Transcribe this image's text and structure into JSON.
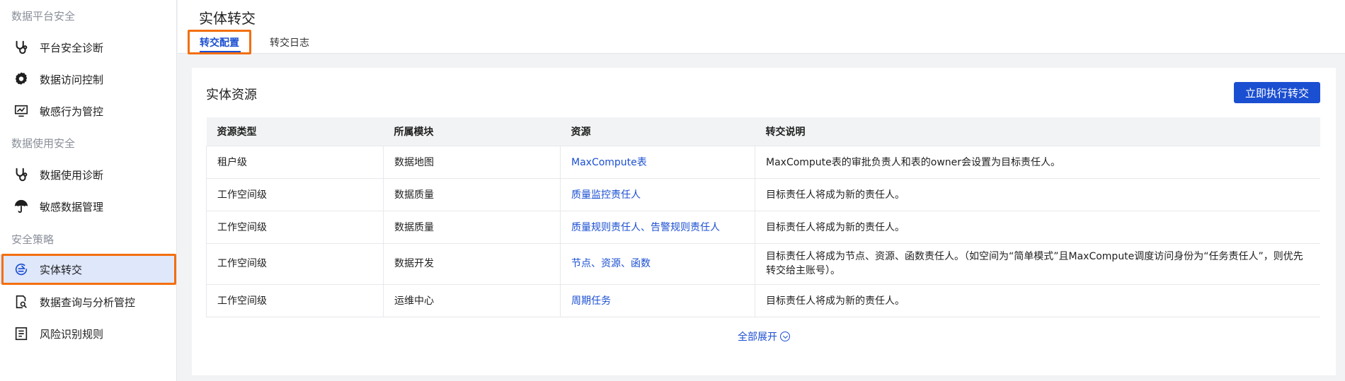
{
  "sidebar": {
    "groups": [
      {
        "title": "数据平台安全",
        "items": [
          {
            "label": "平台安全诊断",
            "icon": "stethoscope-icon"
          },
          {
            "label": "数据访问控制",
            "icon": "gear-icon"
          },
          {
            "label": "敏感行为管控",
            "icon": "monitor-chart-icon"
          }
        ]
      },
      {
        "title": "数据使用安全",
        "items": [
          {
            "label": "数据使用诊断",
            "icon": "stethoscope-icon"
          },
          {
            "label": "敏感数据管理",
            "icon": "umbrella-icon"
          }
        ]
      },
      {
        "title": "安全策略",
        "items": [
          {
            "label": "实体转交",
            "icon": "transfer-icon",
            "active": true
          },
          {
            "label": "数据查询与分析管控",
            "icon": "search-doc-icon"
          },
          {
            "label": "风险识别规则",
            "icon": "list-doc-icon"
          }
        ]
      }
    ]
  },
  "header": {
    "title": "实体转交",
    "tabs": [
      {
        "label": "转交配置",
        "active": true
      },
      {
        "label": "转交日志",
        "active": false
      }
    ]
  },
  "card": {
    "title": "实体资源",
    "action_label": "立即执行转交",
    "columns": [
      "资源类型",
      "所属模块",
      "资源",
      "转交说明"
    ],
    "rows": [
      {
        "type": "租户级",
        "module": "数据地图",
        "resource": "MaxCompute表",
        "desc": "MaxCompute表的审批负责人和表的owner会设置为目标责任人。"
      },
      {
        "type": "工作空间级",
        "module": "数据质量",
        "resource": "质量监控责任人",
        "desc": "目标责任人将成为新的责任人。"
      },
      {
        "type": "工作空间级",
        "module": "数据质量",
        "resource": "质量规则责任人、告警规则责任人",
        "desc": "目标责任人将成为新的责任人。"
      },
      {
        "type": "工作空间级",
        "module": "数据开发",
        "resource": "节点、资源、函数",
        "desc": "目标责任人将成为节点、资源、函数责任人。（如空间为“简单模式”且MaxCompute调度访问身份为“任务责任人”，则优先转交给主账号）。"
      },
      {
        "type": "工作空间级",
        "module": "运维中心",
        "resource": "周期任务",
        "desc": "目标责任人将成为新的责任人。"
      }
    ],
    "expand_label": "全部展开"
  },
  "colors": {
    "accent": "#1b4fd1",
    "highlight": "#f36f0f",
    "active_bg": "#dfe7fb"
  }
}
